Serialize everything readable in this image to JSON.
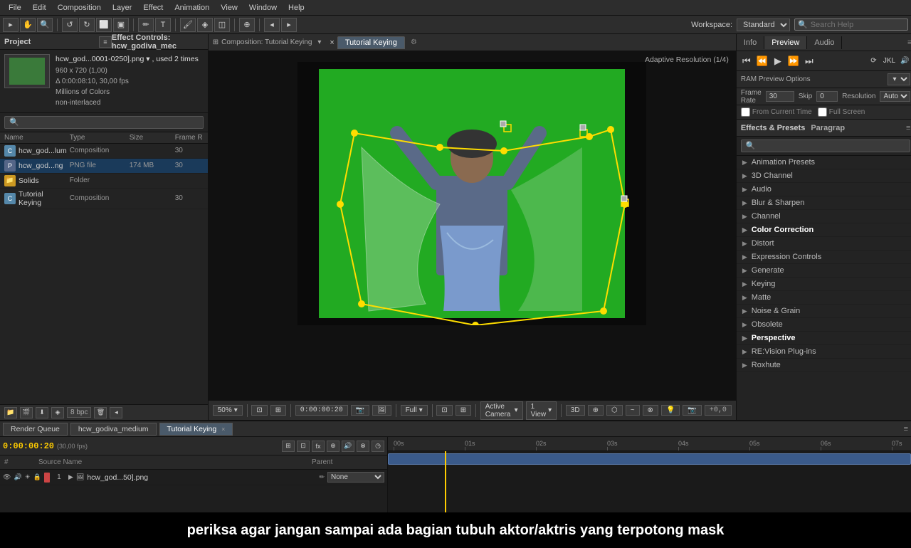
{
  "menubar": {
    "items": [
      "File",
      "Edit",
      "Composition",
      "Layer",
      "Effect",
      "Animation",
      "View",
      "Window",
      "Help"
    ]
  },
  "toolbar": {
    "workspace_label": "Workspace:",
    "workspace_value": "Standard",
    "search_placeholder": "Search Help"
  },
  "project_panel": {
    "title": "Project",
    "asset_name": "hcw_god...0001-0250].png",
    "asset_used": "used 2 times",
    "asset_dims": "960 x 720 (1,00)",
    "asset_delta": "Δ 0:00:08:10, 30,00 fps",
    "asset_colors": "Millions of Colors",
    "asset_interlace": "non-interlaced",
    "search_placeholder": "🔍",
    "columns": [
      "Name",
      "Type",
      "Size",
      "Frame R"
    ],
    "items": [
      {
        "name": "hcw_god...lum",
        "type": "Composition",
        "size": "",
        "frame": "30",
        "icon": "comp"
      },
      {
        "name": "hcw_god...ng",
        "type": "PNG file",
        "size": "174 MB",
        "frame": "30",
        "icon": "png"
      },
      {
        "name": "Solids",
        "type": "Folder",
        "size": "",
        "frame": "",
        "icon": "folder"
      },
      {
        "name": "Tutorial Keying",
        "type": "Composition",
        "size": "",
        "frame": "30",
        "icon": "comp"
      }
    ],
    "bpc": "8 bpc"
  },
  "composition": {
    "title": "Composition: Tutorial Keying",
    "tab_label": "Tutorial Keying",
    "viewer_info": "Adaptive Resolution (1/4)",
    "close_icon": "×"
  },
  "viewer_controls": {
    "zoom": "50%",
    "timecode": "0:00:00:20",
    "quality": "Full",
    "camera": "Active Camera",
    "view_mode": "1 View",
    "offset": "+0,0"
  },
  "right_panel": {
    "tabs": [
      "Info",
      "Preview",
      "Audio"
    ],
    "active_tab": "Preview",
    "ram_preview_label": "RAM Preview Options",
    "frame_rate_label": "Frame Rate",
    "skip_label": "Skip",
    "resolution_label": "Resolution",
    "frame_rate_value": "30",
    "skip_value": "0",
    "resolution_value": "Auto",
    "from_current_label": "From Current Time",
    "full_screen_label": "Full Screen"
  },
  "effects_panel": {
    "title": "Effects & Presets",
    "para_tab": "Paragrap",
    "search_placeholder": "🔍",
    "items": [
      {
        "name": "Animation Presets",
        "highlighted": false
      },
      {
        "name": "3D Channel",
        "highlighted": false
      },
      {
        "name": "Audio",
        "highlighted": false
      },
      {
        "name": "Blur & Sharpen",
        "highlighted": false
      },
      {
        "name": "Channel",
        "highlighted": false
      },
      {
        "name": "Color Correction",
        "highlighted": true
      },
      {
        "name": "Distort",
        "highlighted": false
      },
      {
        "name": "Expression Controls",
        "highlighted": false
      },
      {
        "name": "Generate",
        "highlighted": false
      },
      {
        "name": "Keying",
        "highlighted": false
      },
      {
        "name": "Matte",
        "highlighted": false
      },
      {
        "name": "Noise & Grain",
        "highlighted": false
      },
      {
        "name": "Obsolete",
        "highlighted": false
      },
      {
        "name": "Perspective",
        "highlighted": true
      },
      {
        "name": "RE:Vision Plug-ins",
        "highlighted": false
      },
      {
        "name": "Roxhute",
        "highlighted": false
      }
    ]
  },
  "timeline": {
    "tabs": [
      "Render Queue",
      "hcw_godiva_medium",
      "Tutorial Keying"
    ],
    "active_tab": "Tutorial Keying",
    "timecode": "0:00:00:20",
    "fps": "(30,00 fps)",
    "columns": [
      "#",
      "Source Name",
      "Parent"
    ],
    "layers": [
      {
        "num": "1",
        "name": "hcw_god...50].png",
        "parent": "None",
        "color": "#cc4444"
      }
    ],
    "ruler_marks": [
      "00s",
      "01s",
      "02s",
      "03s",
      "04s",
      "05s",
      "06s",
      "07s"
    ]
  },
  "subtitle": {
    "text": "periksa agar jangan sampai ada bagian tubuh aktor/aktris yang terpotong mask"
  }
}
